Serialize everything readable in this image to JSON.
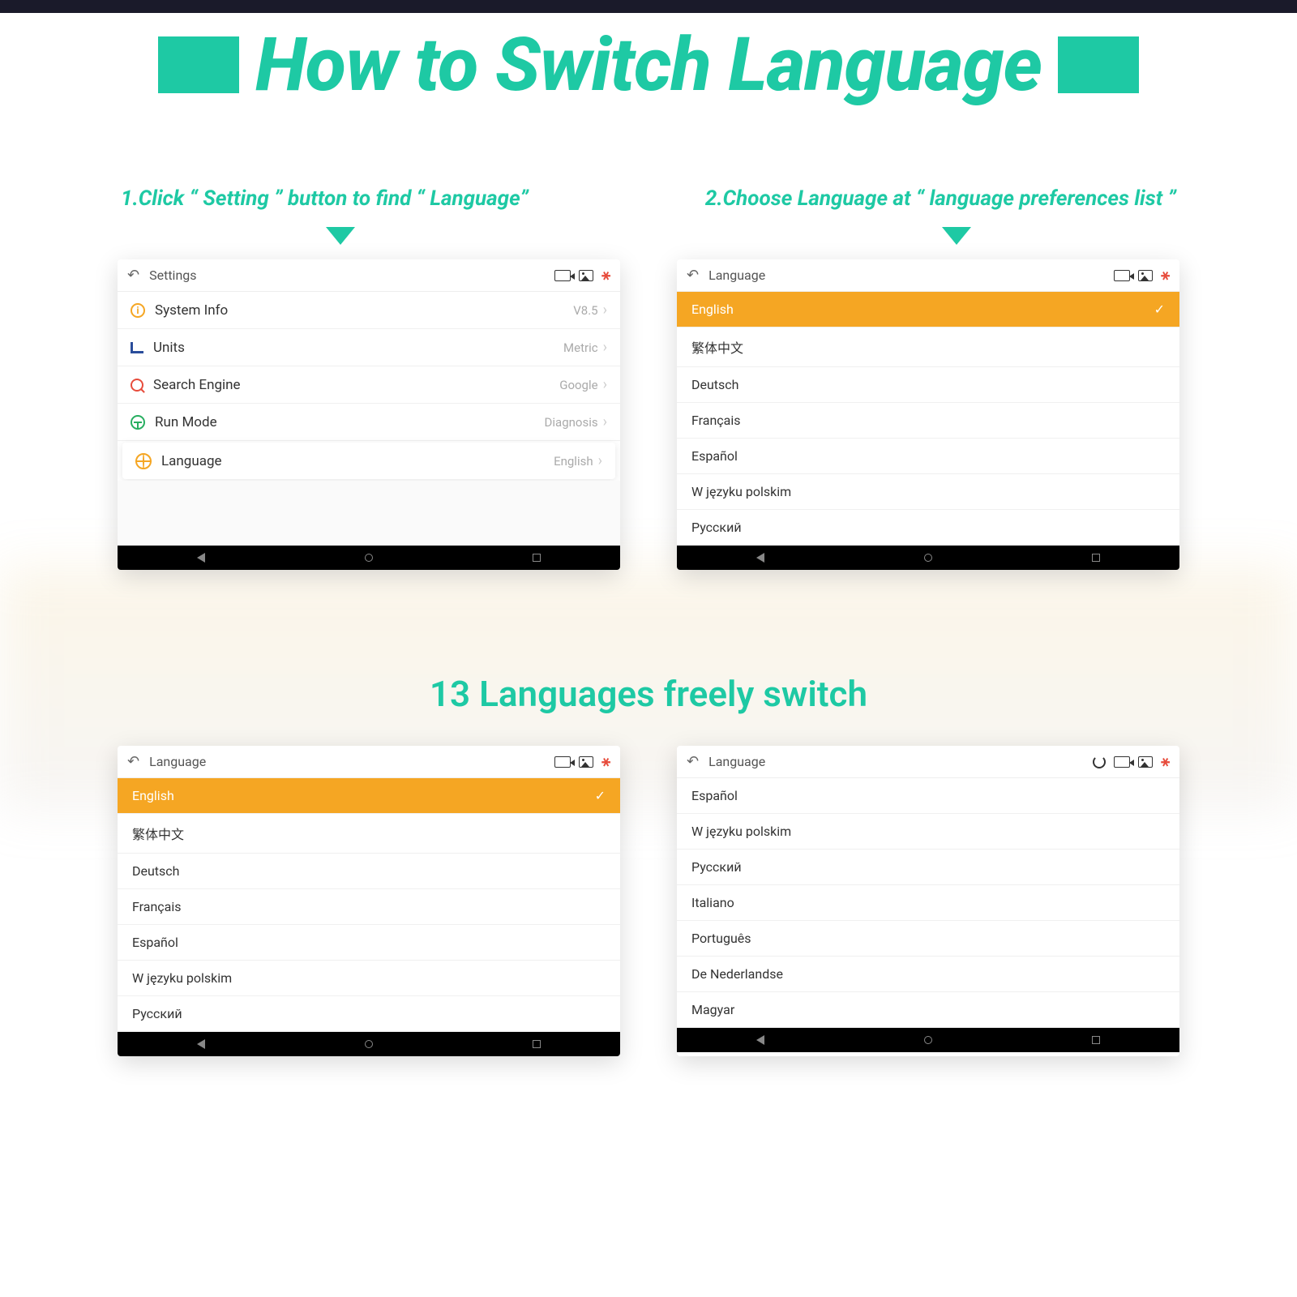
{
  "header": {
    "title": "How to Switch Language"
  },
  "steps": {
    "s1": "1.Click “ Setting ” button to find “ Language”",
    "s2": "2.Choose Language at “ language preferences list ”"
  },
  "subtitle": "13 Languages freely switch",
  "tablet1": {
    "appbar_title": "Settings",
    "rows": [
      {
        "label": "System Info",
        "value": "V8.5"
      },
      {
        "label": "Units",
        "value": "Metric"
      },
      {
        "label": "Search Engine",
        "value": "Google"
      },
      {
        "label": "Run Mode",
        "value": "Diagnosis"
      },
      {
        "label": "Language",
        "value": "English"
      }
    ]
  },
  "tablet2": {
    "appbar_title": "Language",
    "selected": "English",
    "items": [
      "繁体中文",
      "Deutsch",
      "Français",
      "Español",
      "W języku polskim",
      "Русский"
    ]
  },
  "tablet3": {
    "appbar_title": "Language",
    "selected": "English",
    "items": [
      "繁体中文",
      "Deutsch",
      "Français",
      "Español",
      "W języku polskim",
      "Русский"
    ]
  },
  "tablet4": {
    "appbar_title": "Language",
    "items": [
      "Español",
      "W języku polskim",
      "Русский",
      "Italiano",
      "Português",
      "De Nederlandse",
      "Magyar"
    ]
  }
}
